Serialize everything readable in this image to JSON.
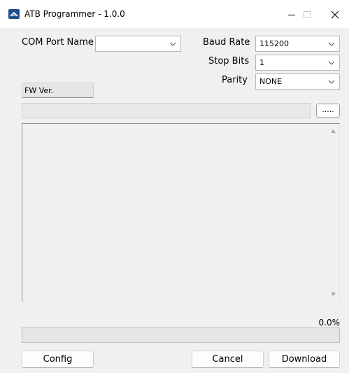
{
  "window": {
    "title": "ATB Programmer - 1.0.0"
  },
  "titlebar": {
    "app_icon": "atb-app-icon",
    "minimize_icon": "minimize-icon",
    "maximize_icon": "maximize-icon",
    "close_icon": "close-icon"
  },
  "com_port": {
    "label": "COM Port Name",
    "value": ""
  },
  "baud_rate": {
    "label": "Baud Rate",
    "value": "115200"
  },
  "stop_bits": {
    "label": "Stop Bits",
    "value": "1"
  },
  "parity": {
    "label": "Parity",
    "value": "NONE"
  },
  "fw_version": {
    "label": "FW Ver."
  },
  "file_path": {
    "value": ""
  },
  "browse_button": {
    "label": "....."
  },
  "log": {
    "text": ""
  },
  "progress": {
    "text": "0.0%",
    "fraction": 0.0
  },
  "buttons": {
    "config": "Config",
    "cancel": "Cancel",
    "download": "Download"
  },
  "colors": {
    "title_bar_bg": "#ffffff",
    "window_bg": "#f0f0f0",
    "app_icon": "#1f4e8c",
    "progress_fill": "#06b025"
  }
}
